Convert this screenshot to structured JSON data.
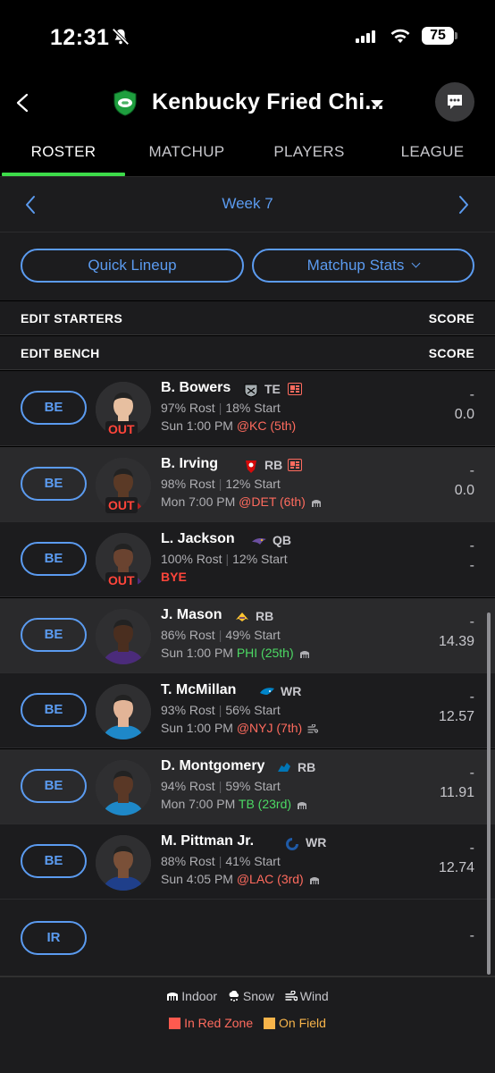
{
  "status_bar": {
    "time": "12:31",
    "battery": "75"
  },
  "header": {
    "team_name": "Kenbucky Fried Chi..."
  },
  "tabs": [
    "ROSTER",
    "MATCHUP",
    "PLAYERS",
    "LEAGUE"
  ],
  "week": {
    "label": "Week 7"
  },
  "actions": {
    "quick_lineup": "Quick Lineup",
    "matchup_stats": "Matchup Stats"
  },
  "sections": {
    "starters": "EDIT STARTERS",
    "bench": "EDIT BENCH",
    "score_label": "SCORE"
  },
  "players": [
    {
      "slot": "BE",
      "name": "B. Bowers",
      "team_icon": "raiders-logo",
      "pos": "TE",
      "news": true,
      "status": "OUT",
      "rost": "97% Rost",
      "start": "18% Start",
      "time": "Sun 1:00 PM",
      "opp": "@KC (5th)",
      "opp_class": "bad",
      "weather": "",
      "proj": "-",
      "pts": "0.0"
    },
    {
      "slot": "BE",
      "name": "B. Irving",
      "team_icon": "buccaneers-logo",
      "pos": "RB",
      "news": true,
      "status": "OUT",
      "rost": "98% Rost",
      "start": "12% Start",
      "time": "Mon 7:00 PM",
      "opp": "@DET (6th)",
      "opp_class": "bad",
      "weather": "indoor",
      "proj": "-",
      "pts": "0.0"
    },
    {
      "slot": "BE",
      "name": "L. Jackson",
      "team_icon": "ravens-logo",
      "pos": "QB",
      "news": false,
      "status": "OUT",
      "rost": "100% Rost",
      "start": "12% Start",
      "time": "",
      "opp": "BYE",
      "opp_class": "bye",
      "weather": "",
      "proj": "-",
      "pts": "-"
    },
    {
      "slot": "BE",
      "name": "J. Mason",
      "team_icon": "vikings-logo",
      "pos": "RB",
      "news": false,
      "status": "",
      "rost": "86% Rost",
      "start": "49% Start",
      "time": "Sun 1:00 PM",
      "opp": "PHI (25th)",
      "opp_class": "good",
      "weather": "indoor",
      "proj": "-",
      "pts": "14.39"
    },
    {
      "slot": "BE",
      "name": "T. McMillan",
      "team_icon": "panthers-logo",
      "pos": "WR",
      "news": false,
      "status": "",
      "rost": "93% Rost",
      "start": "56% Start",
      "time": "Sun 1:00 PM",
      "opp": "@NYJ (7th)",
      "opp_class": "bad",
      "weather": "wind",
      "proj": "-",
      "pts": "12.57"
    },
    {
      "slot": "BE",
      "name": "D. Montgomery",
      "team_icon": "lions-logo",
      "pos": "RB",
      "news": false,
      "status": "",
      "rost": "94% Rost",
      "start": "59% Start",
      "time": "Mon 7:00 PM",
      "opp": "TB (23rd)",
      "opp_class": "good",
      "weather": "indoor",
      "proj": "-",
      "pts": "11.91"
    },
    {
      "slot": "BE",
      "name": "M. Pittman Jr.",
      "team_icon": "colts-logo",
      "pos": "WR",
      "news": false,
      "status": "",
      "rost": "88% Rost",
      "start": "41% Start",
      "time": "Sun 4:05 PM",
      "opp": "@LAC (3rd)",
      "opp_class": "bad",
      "weather": "indoor",
      "proj": "-",
      "pts": "12.74"
    }
  ],
  "ir": {
    "slot": "IR",
    "pts": "-"
  },
  "legend": {
    "indoor": "Indoor",
    "snow": "Snow",
    "wind": "Wind",
    "red_zone": "In Red Zone",
    "on_field": "On Field",
    "red_zone_color": "#ff5a4f",
    "on_field_color": "#f7b44a"
  },
  "colors": {
    "accent": "#5b9bf0",
    "tab_underline": "#3ddc4a",
    "out": "#ff453a"
  }
}
